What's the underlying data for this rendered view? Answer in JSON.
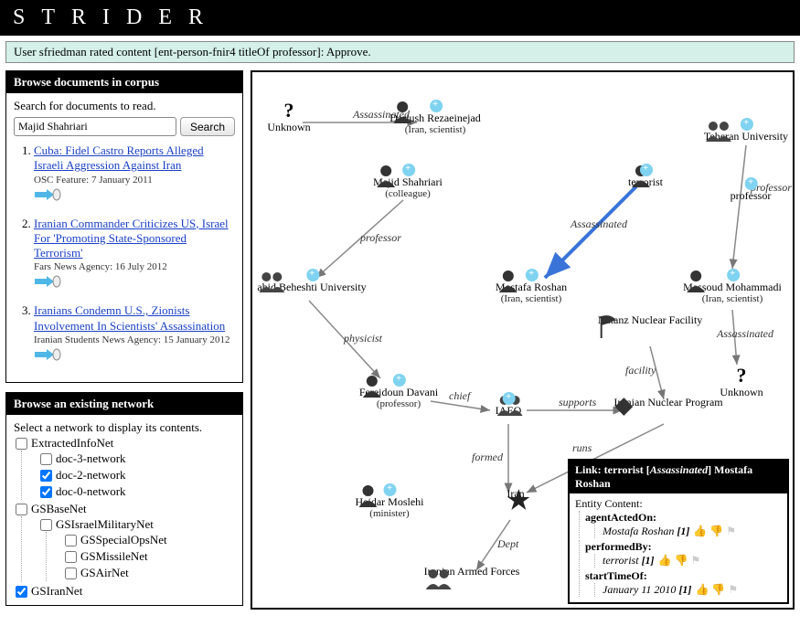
{
  "app": {
    "title": "STRIDER"
  },
  "notice": "User sfriedman rated content [ent-person-fnir4 titleOf professor]: Approve.",
  "browse_docs": {
    "header": "Browse documents in corpus",
    "prompt": "Search for documents to read.",
    "search_value": "Majid Shahriari",
    "search_button": "Search",
    "results": [
      {
        "title": "Cuba: Fidel Castro Reports Alleged Israeli Aggression Against Iran",
        "source": "OSC Feature: 7 January 2011"
      },
      {
        "title": "Iranian Commander Criticizes US, Israel For 'Promoting State-Sponsored Terrorism'",
        "source": "Fars News Agency: 16 July 2012"
      },
      {
        "title": "Iranians Condemn U.S., Zionists Involvement In Scientists' Assassination",
        "source": "Iranian Students News Agency: 15 January 2012"
      }
    ]
  },
  "browse_net": {
    "header": "Browse an existing network",
    "prompt": "Select a network to display its contents.",
    "tree": {
      "root1": "ExtractedInfoNet",
      "r1c": [
        "doc-3-network",
        "doc-2-network",
        "doc-0-network"
      ],
      "root2": "GSBaseNet",
      "r2c": [
        "GSIsraelMilitaryNet",
        "GSSpecialOpsNet",
        "GSMissileNet",
        "GSAirNet"
      ],
      "root2b": "GSIranNet"
    }
  },
  "graph": {
    "nodes": {
      "unknown1": {
        "label": "Unknown"
      },
      "rezaeinejad": {
        "label": "Dariush Rezaeinejad",
        "sub": "(Iran, scientist)"
      },
      "teheranU": {
        "label": "Teheran University"
      },
      "shahriari": {
        "label": "Majid Shahriari",
        "sub": "(colleague)"
      },
      "terrorist": {
        "label": "terrorist"
      },
      "professor_role": {
        "label": "professor"
      },
      "beheshtiU": {
        "label": "ahid Beheshti University"
      },
      "roshan": {
        "label": "Mostafa Roshan",
        "sub": "(Iran, scientist)"
      },
      "mohammadi": {
        "label": "Massoud Mohammadi",
        "sub": "(Iran, scientist)"
      },
      "physicist_role": {
        "label": "physicist"
      },
      "natanz": {
        "label": "Natanz Nuclear Facility"
      },
      "unknown2": {
        "label": "Unknown"
      },
      "davani": {
        "label": "Fereidoun Davani",
        "sub": "(professor)"
      },
      "iaeo": {
        "label": "IAEO"
      },
      "nuclearprog": {
        "label": "Iranian Nuclear Program"
      },
      "moslehi": {
        "label": "Heidar Moslehi",
        "sub": "(minister)"
      },
      "iran": {
        "label": "Iran"
      },
      "armedforces": {
        "label": "Iranian Armed Forces"
      }
    },
    "edges": {
      "e1": "Assassinated",
      "e2": "professor",
      "e3": "Assassinated",
      "e4": "professor",
      "e5": "physicist",
      "e6": "Assassinated",
      "e7": "chief",
      "e8": "supports",
      "e9": "facility",
      "e10": "formed",
      "e11": "runs",
      "e12": "Dept"
    }
  },
  "details": {
    "header_pre": "Link: terrorist [",
    "header_em": "Assassinated",
    "header_post": "] Mostafa Roshan",
    "title": "Entity Content:",
    "rows": [
      {
        "key": "agentActedOn:",
        "val": "Mostafa Roshan",
        "count": "[1]"
      },
      {
        "key": "performedBy:",
        "val": "terrorist",
        "count": "[1]"
      },
      {
        "key": "startTimeOf:",
        "val": "January 11 2010",
        "count": "[1]"
      }
    ]
  }
}
